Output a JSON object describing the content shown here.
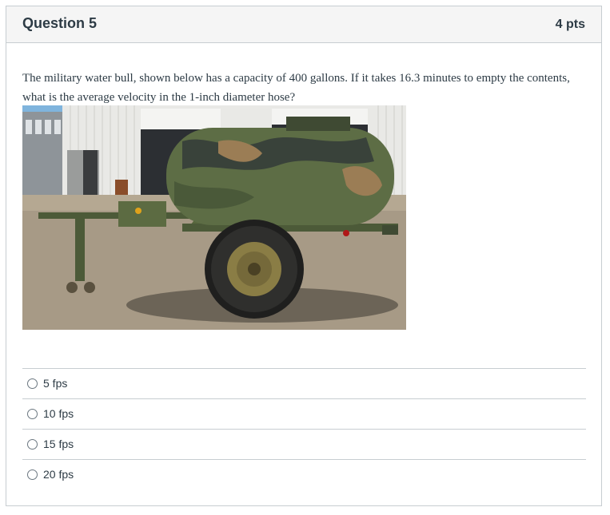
{
  "question": {
    "title": "Question 5",
    "points": "4 pts",
    "text": "The military water bull, shown below has a capacity of 400 gallons.  If it takes 16.3 minutes to empty the contents, what is the average velocity in the 1-inch diameter hose?"
  },
  "image": {
    "subject": "military water trailer"
  },
  "answers": [
    {
      "label": "5 fps"
    },
    {
      "label": "10 fps"
    },
    {
      "label": "15 fps"
    },
    {
      "label": "20 fps"
    }
  ]
}
